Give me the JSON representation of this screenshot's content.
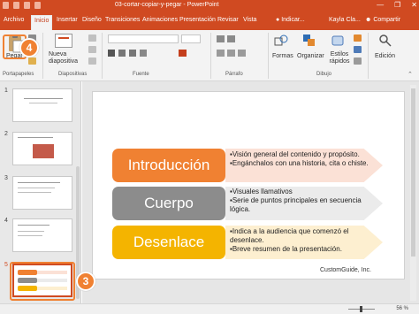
{
  "window": {
    "title": "03-cortar-copiar-y-pegar  -  PowerPoint",
    "minimize": "—",
    "restore": "❐",
    "close": "✕"
  },
  "tabs": [
    "Archivo",
    "Inicio",
    "Insertar",
    "Diseño",
    "Transiciones",
    "Animaciones",
    "Presentación",
    "Revisar",
    "Vista"
  ],
  "tell_me": "Indicar...",
  "user_name": "Kayla Cla...",
  "share": "Compartir",
  "ribbon": {
    "paste_label": "Pegar",
    "new_slide_label": "Nueva diapositiva",
    "shapes_label": "Formas",
    "arrange_label": "Organizar",
    "quick_styles_label": "Estilos rápidos",
    "editing_label": "Edición",
    "groups": {
      "clipboard": "Portapapeles",
      "slides": "Diapositivas",
      "font": "Fuente",
      "paragraph": "Párrafo",
      "drawing": "Dibujo"
    }
  },
  "thumbnails": [
    {
      "number": "1"
    },
    {
      "number": "2"
    },
    {
      "number": "3"
    },
    {
      "number": "4"
    },
    {
      "number": "5"
    }
  ],
  "slide": {
    "rows": [
      {
        "label": "Introducción",
        "color": "#f08132",
        "bullets": [
          "Visión general del contenido y propósito.",
          "Engánchalos con una historia, cita o chiste."
        ]
      },
      {
        "label": "Cuerpo",
        "color": "#8c8c8c",
        "bullets": [
          "Visuales llamativos",
          "Serie de puntos principales en secuencia lógica."
        ]
      },
      {
        "label": "Desenlace",
        "color": "#f4b400",
        "bullets": [
          "Indica a la audiencia que comenzó el desenlace.",
          "Breve resumen de la presentación."
        ]
      }
    ],
    "brand": "CustomGuide, Inc."
  },
  "callouts": {
    "paste_step": "4",
    "thumb_step": "3"
  },
  "status": {
    "zoom": "56 %"
  },
  "colors": {
    "accent": "#d04a21",
    "callout": "#f08132"
  }
}
